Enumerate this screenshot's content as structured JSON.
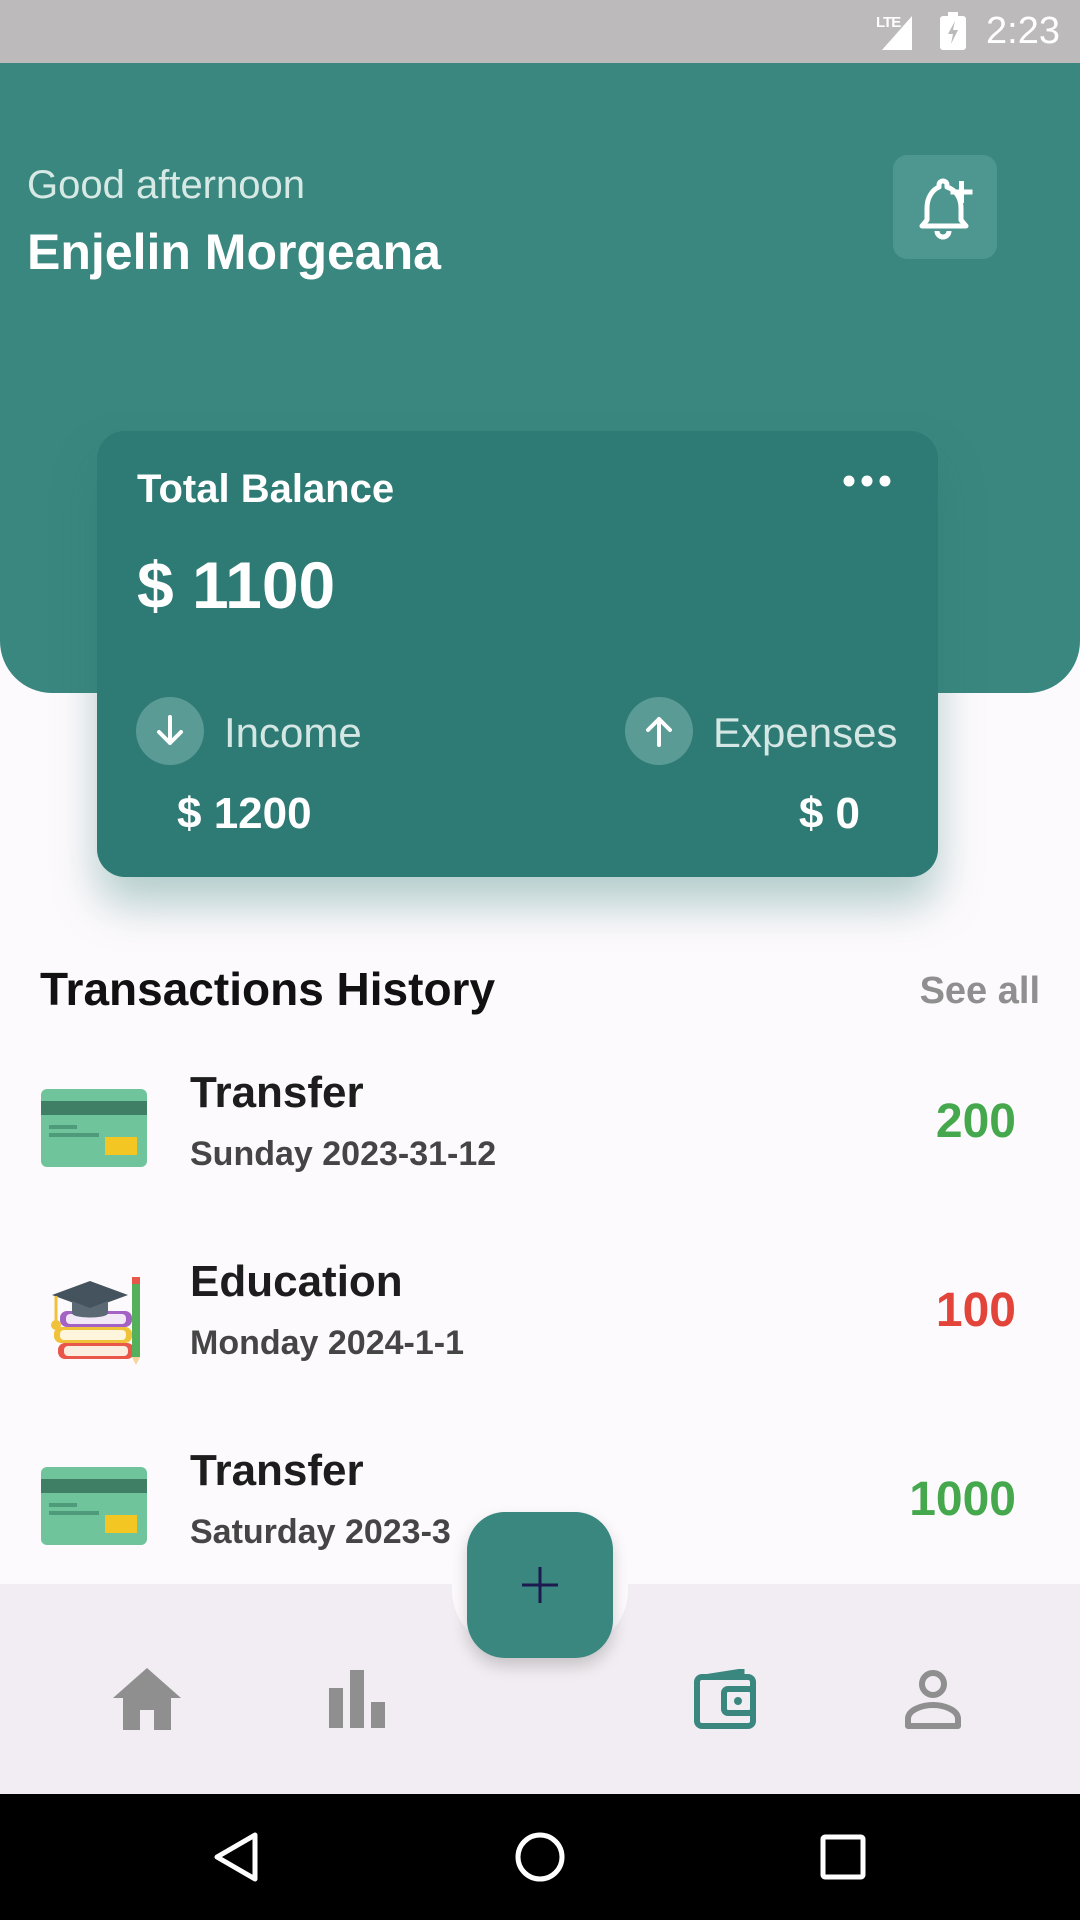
{
  "status_bar": {
    "network": "LTE",
    "time": "2:23"
  },
  "header": {
    "greeting": "Good afternoon",
    "name": "Enjelin Morgeana"
  },
  "balance": {
    "label": "Total Balance",
    "amount": "$ 1100",
    "income_label": "Income",
    "income_amount": "$ 1200",
    "expenses_label": "Expenses",
    "expenses_amount": "$ 0"
  },
  "transactions": {
    "title": "Transactions History",
    "see_all": "See all",
    "items": [
      {
        "name": "Transfer",
        "date": "Sunday  2023-31-12",
        "amount": "200",
        "icon": "credit-card-icon",
        "type": "income"
      },
      {
        "name": "Education",
        "date": "Monday  2024-1-1",
        "amount": "100",
        "icon": "education-books-icon",
        "type": "expense"
      },
      {
        "name": "Transfer",
        "date": "Saturday  2023-3",
        "amount": "1000",
        "icon": "credit-card-icon",
        "type": "income"
      }
    ]
  },
  "colors": {
    "primary": "#39877f",
    "card": "#2e7a74",
    "income": "#45a84c",
    "expense": "#e2443a"
  }
}
